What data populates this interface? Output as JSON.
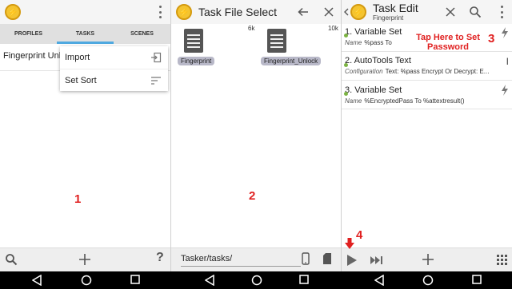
{
  "panel1": {
    "tabs": [
      "PROFILES",
      "TASKS",
      "SCENES"
    ],
    "active_tab": "TASKS",
    "task_name": "Fingerprint Unlock",
    "menu": [
      {
        "label": "Import",
        "icon": "import-icon"
      },
      {
        "label": "Set Sort",
        "icon": "sort-icon"
      }
    ],
    "annotation": "1",
    "bottom_icons": [
      "search-icon",
      "add-icon",
      "help-icon"
    ]
  },
  "panel2": {
    "title": "Task File Select",
    "files": [
      {
        "name": "Fingerprint",
        "size": "6k"
      },
      {
        "name": "Fingerprint_Unlock",
        "size": "10k"
      }
    ],
    "annotation": "2",
    "path": "Tasker/tasks/",
    "bottom_icons": [
      "phone-icon",
      "sdcard-icon"
    ]
  },
  "panel3": {
    "title": "Task Edit",
    "subtitle": "Fingerprint",
    "actions": [
      {
        "number": "1.",
        "name": "Variable Set",
        "arg_label": "Name",
        "arg_value": "%pass To"
      },
      {
        "number": "2.",
        "name": "AutoTools Text",
        "arg_label": "Configuration",
        "arg_value": "Text: %pass Encrypt Or Decrypt: E..."
      },
      {
        "number": "3.",
        "name": "Variable Set",
        "arg_label": "Name",
        "arg_value": "%EncryptedPass To %attextresult()"
      }
    ],
    "callout": "Tap Here to Set Password",
    "annotation3": "3",
    "annotation4": "4",
    "bottom_icons": [
      "play-icon",
      "skip-forward-icon",
      "add-icon",
      "grid-icon"
    ]
  },
  "colors": {
    "annotation": "#e02020",
    "tab_indicator": "#4fa9e0",
    "app_icon": "#f4c430"
  }
}
